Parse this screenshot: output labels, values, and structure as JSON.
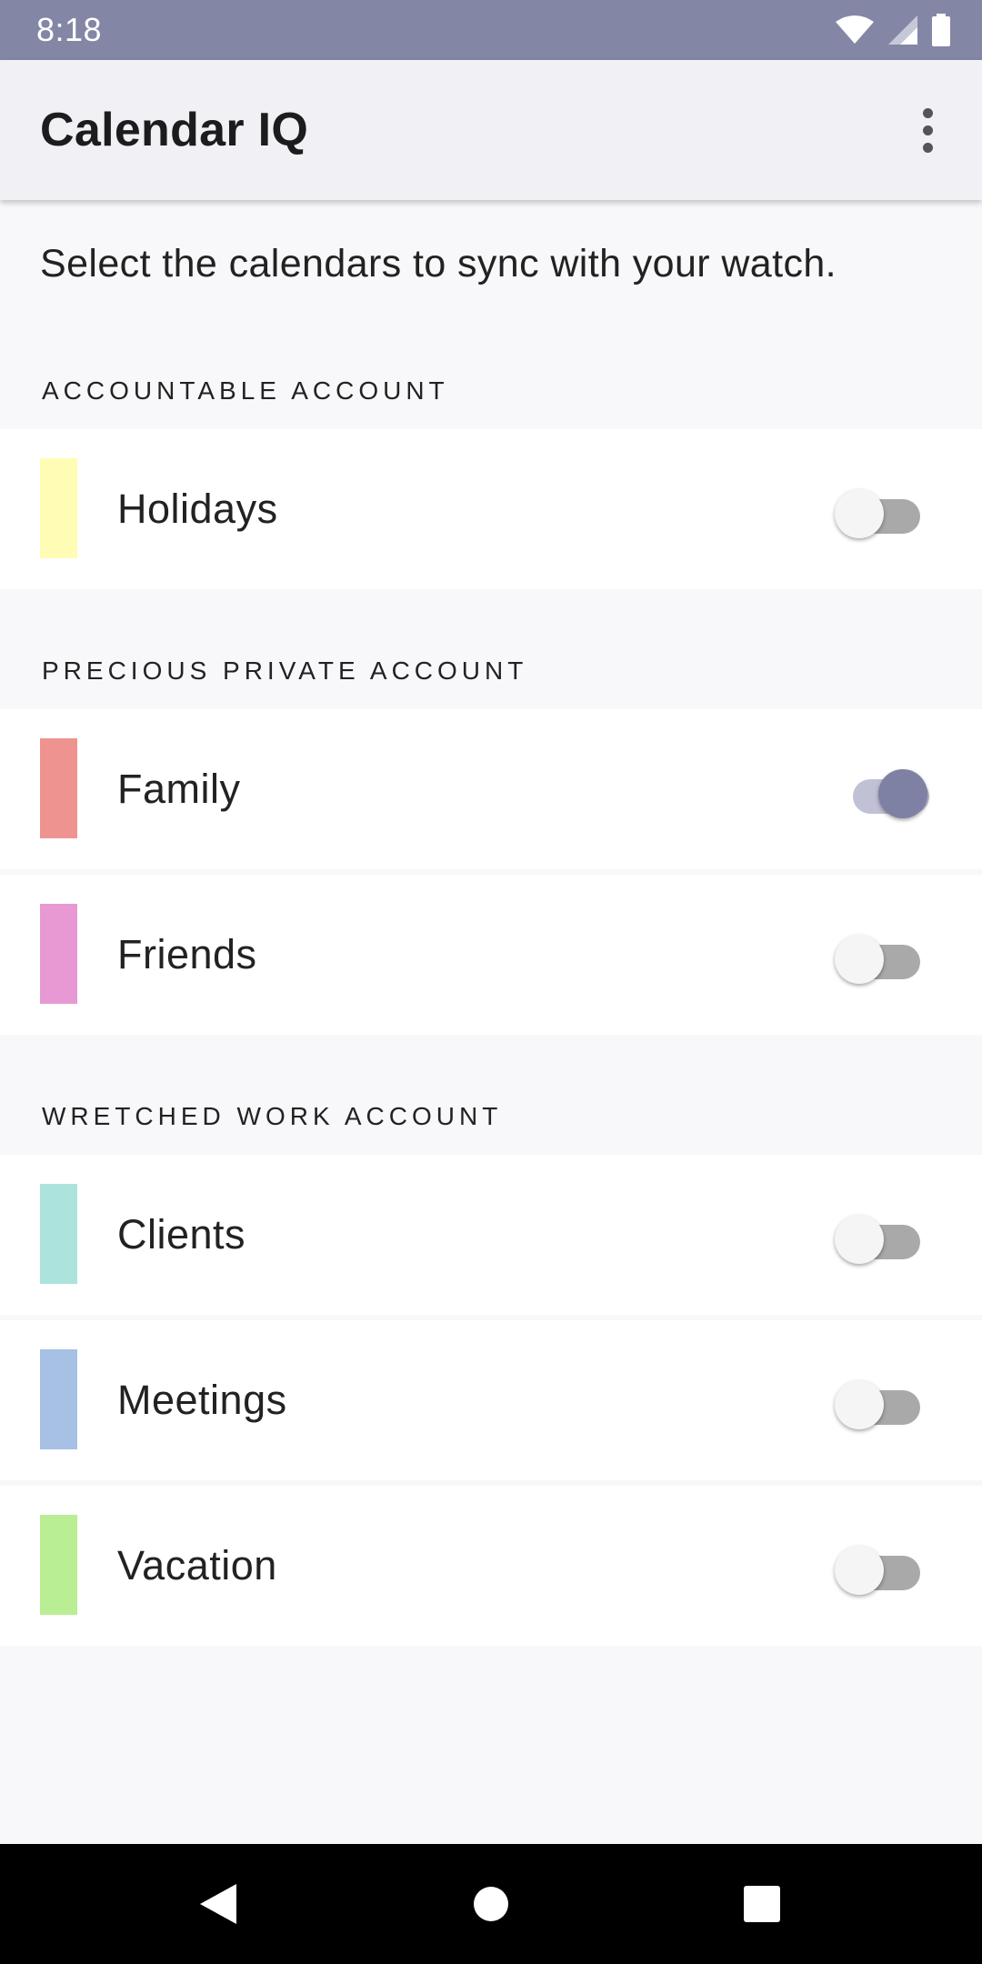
{
  "status_bar": {
    "time": "8:18",
    "icons": [
      "wifi-icon",
      "signal-icon",
      "battery-icon"
    ]
  },
  "app_bar": {
    "title": "Calendar IQ",
    "menu_icon": "more-vert-icon"
  },
  "intro_text": "Select the calendars to sync with your watch.",
  "sections": [
    {
      "header": "ACCOUNTABLE ACCOUNT",
      "calendars": [
        {
          "label": "Holidays",
          "color": "#fffcb5",
          "enabled": false
        }
      ]
    },
    {
      "header": "PRECIOUS PRIVATE ACCOUNT",
      "calendars": [
        {
          "label": "Family",
          "color": "#ef9390",
          "enabled": true
        },
        {
          "label": "Friends",
          "color": "#e899d4",
          "enabled": false
        }
      ]
    },
    {
      "header": "WRETCHED WORK ACCOUNT",
      "calendars": [
        {
          "label": "Clients",
          "color": "#ace3dc",
          "enabled": false
        },
        {
          "label": "Meetings",
          "color": "#a6c1e3",
          "enabled": false
        },
        {
          "label": "Vacation",
          "color": "#b9ee94",
          "enabled": false
        }
      ]
    }
  ],
  "colors": {
    "status_bar": "#8486a6",
    "switch_on": "#7e80a4"
  },
  "nav_bar": {
    "icons": [
      "back-icon",
      "home-icon",
      "recents-icon"
    ]
  }
}
